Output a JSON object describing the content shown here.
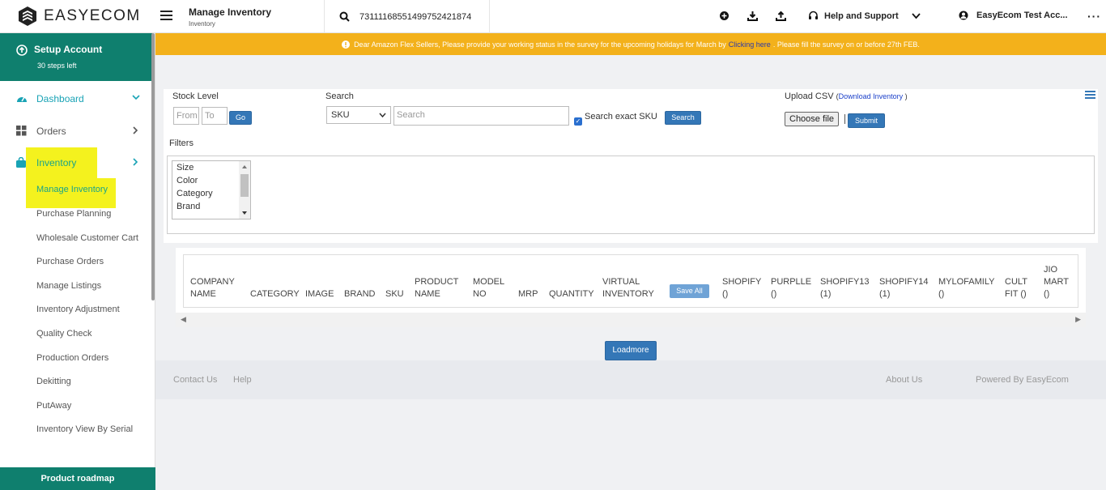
{
  "header": {
    "logo_text": "EASYECOM",
    "page_title": "Manage Inventory",
    "page_subtitle": "Inventory",
    "search_value": "7311116855149975242187‌4",
    "help_label": "Help and Support",
    "account_label": "EasyEcom Test Acc..."
  },
  "sidebar": {
    "setup_title": "Setup Account",
    "setup_sub": "30 steps left",
    "dashboard": "Dashboard",
    "orders": "Orders",
    "inventory": "Inventory",
    "sub_items": [
      "Manage Inventory",
      "Purchase Planning",
      "Wholesale Customer Cart",
      "Purchase Orders",
      "Manage Listings",
      "Inventory Adjustment",
      "Quality Check",
      "Production Orders",
      "Dekitting",
      "PutAway",
      "Inventory View By Serial"
    ],
    "roadmap": "Product roadmap"
  },
  "banner": {
    "text_before": "Dear Amazon Flex Sellers, Please provide your working status in the survey for the upcoming holidays for March by",
    "link": "Clicking here",
    "text_after": ". Please fill the survey on or before 27th FEB."
  },
  "form": {
    "stock_level_label": "Stock Level",
    "from_placeholder": "From",
    "to_placeholder": "To",
    "go_label": "Go",
    "search_label": "Search",
    "search_type": "SKU",
    "search_placeholder": "Search",
    "exact_sku_label": "Search exact SKU",
    "search_button": "Search",
    "upload_label": "Upload CSV",
    "download_link": "Download Inventory",
    "choose_file": "Choose file",
    "submit": "Submit",
    "filters_label": "Filters",
    "filter_options": [
      "Size",
      "Color",
      "Category",
      "Brand"
    ]
  },
  "table": {
    "headers": [
      [
        "COMPANY",
        "NAME"
      ],
      [
        "CATEGORY"
      ],
      [
        "IMAGE"
      ],
      [
        "BRAND"
      ],
      [
        "SKU"
      ],
      [
        "PRODUCT",
        "NAME"
      ],
      [
        "MODEL",
        "NO"
      ],
      [
        "MRP"
      ],
      [
        "QUANTITY"
      ],
      [
        "VIRTUAL",
        "INVENTORY"
      ],
      [
        "SHOPIFY",
        "()"
      ],
      [
        "PURPLLE",
        "()"
      ],
      [
        "SHOPIFY13",
        "(1)"
      ],
      [
        "SHOPIFY14",
        "(1)"
      ],
      [
        "MYLOFAMILY",
        "()"
      ],
      [
        "CULT",
        "FIT ()"
      ],
      [
        "JIO",
        "MART",
        "()"
      ]
    ],
    "save_all": "Save All"
  },
  "loadmore": "Loadmore",
  "footer": {
    "contact": "Contact Us",
    "help": "Help",
    "about": "About Us",
    "powered": "Powered By EasyEcom"
  },
  "colors": {
    "brand_teal": "#0f7f6e",
    "banner_yellow": "#f3b11b",
    "button_blue": "#3477b7",
    "highlight_yellow": "#f4f21e"
  }
}
